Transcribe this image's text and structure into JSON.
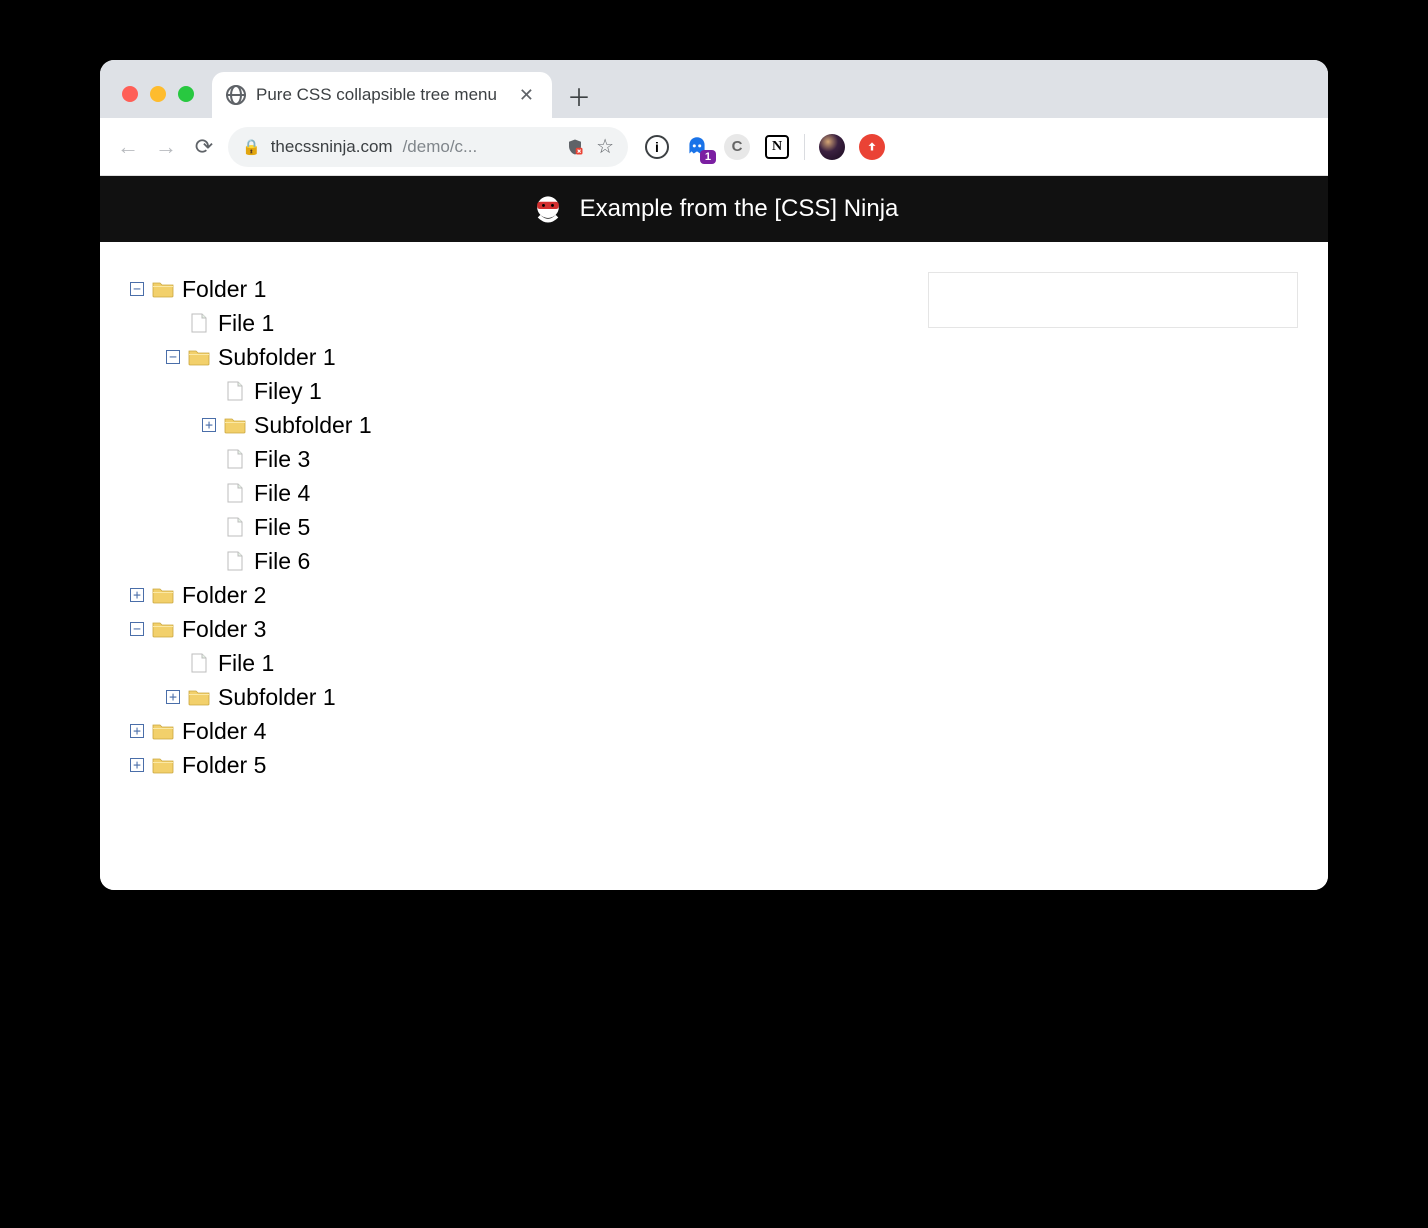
{
  "browser": {
    "tab_title": "Pure CSS collapsible tree menu",
    "url_host": "thecssninja.com",
    "url_path": "/demo/c...",
    "ghost_badge": "1",
    "notion_letter": "N",
    "info_letter": "i"
  },
  "banner": {
    "text": "Example from the [CSS] Ninja"
  },
  "glyphs": {
    "plus": "+",
    "minus": "−"
  },
  "tree": [
    {
      "label": "Folder 1",
      "type": "folder",
      "expanded": true,
      "children": [
        {
          "label": "File 1",
          "type": "file"
        },
        {
          "label": "Subfolder 1",
          "type": "folder",
          "expanded": true,
          "children": [
            {
              "label": "Filey 1",
              "type": "file"
            },
            {
              "label": "Subfolder 1",
              "type": "folder",
              "expanded": false
            },
            {
              "label": "File 3",
              "type": "file"
            },
            {
              "label": "File 4",
              "type": "file"
            },
            {
              "label": "File 5",
              "type": "file"
            },
            {
              "label": "File 6",
              "type": "file"
            }
          ]
        }
      ]
    },
    {
      "label": "Folder 2",
      "type": "folder",
      "expanded": false
    },
    {
      "label": "Folder 3",
      "type": "folder",
      "expanded": true,
      "children": [
        {
          "label": "File 1",
          "type": "file"
        },
        {
          "label": "Subfolder 1",
          "type": "folder",
          "expanded": false
        }
      ]
    },
    {
      "label": "Folder 4",
      "type": "folder",
      "expanded": false
    },
    {
      "label": "Folder 5",
      "type": "folder",
      "expanded": false
    }
  ]
}
